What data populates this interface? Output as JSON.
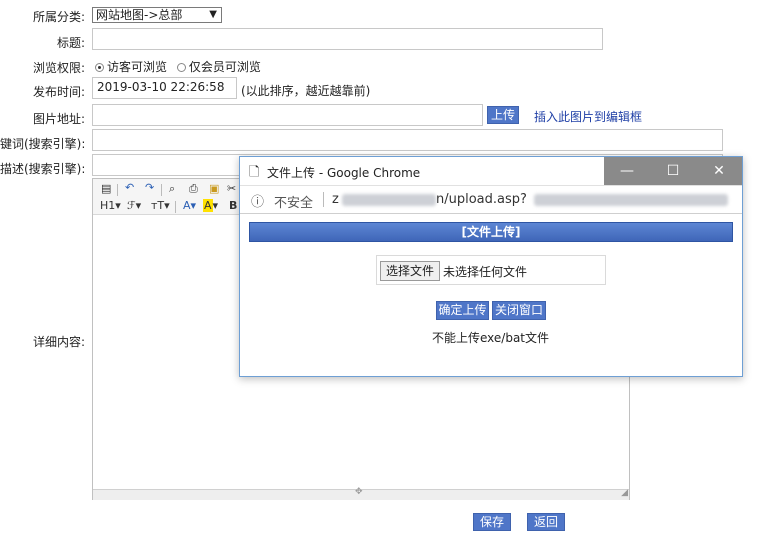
{
  "form": {
    "category_label": "所属分类:",
    "category_value": "网站地图->总部",
    "title_label": "标题:",
    "title_value": "",
    "permission_label": "浏览权限:",
    "permission_options": [
      "访客可浏览",
      "仅会员可浏览"
    ],
    "publish_label": "发布时间:",
    "publish_value": "2019-03-10 22:26:58",
    "publish_hint": "(以此排序，越近越靠前)",
    "image_label": "图片地址:",
    "image_value": "",
    "upload_button": "上传",
    "insert_link": "插入此图片到编辑框",
    "keywords_label": "键词(搜索引擎):",
    "description_label": "描述(搜索引擎):",
    "content_label": "详细内容:",
    "save_button": "保存",
    "back_button": "返回"
  },
  "editor_toolbar": {
    "heading": "H1",
    "font_family": "ℱ",
    "font_size": "тT",
    "font_color": "A",
    "bg_color": "A",
    "bold": "B"
  },
  "popup": {
    "title": "文件上传 - Google Chrome",
    "not_secure": "不安全",
    "url_prefix": "z",
    "url_visible": "n/upload.asp?",
    "header": "[文件上传]",
    "choose_file": "选择文件",
    "no_file": "未选择任何文件",
    "confirm_button": "确定上传",
    "close_button": "关闭窗口",
    "notice": "不能上传exe/bat文件"
  },
  "icons": [
    "file-icon",
    "info-icon",
    "minimize-icon",
    "maximize-icon",
    "close-icon",
    "undo-icon",
    "redo-icon",
    "print-icon"
  ]
}
